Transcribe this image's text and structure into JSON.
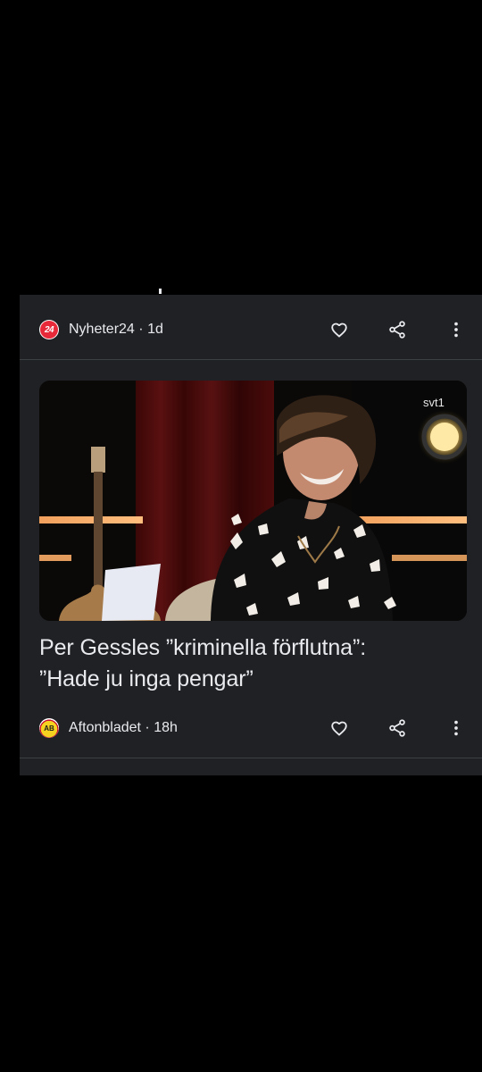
{
  "article_1": {
    "source_name": "Nyheter24",
    "age": "1d",
    "logo_text": "24"
  },
  "article_2": {
    "headline_line_1": "Per Gessles ”kriminella förflutna”:",
    "headline_line_2": "”Hade ju inga pengar”",
    "image_watermark": "svt1",
    "source_name": "Aftonbladet",
    "age": "18h",
    "logo_text": "AB"
  },
  "separator": "·",
  "icons": {
    "like": "heart-outline-icon",
    "share": "share-icon",
    "menu": "more-vertical-icon"
  },
  "colors": {
    "background": "#000000",
    "card": "#202124",
    "text": "#e8eaed",
    "divider": "#3c4043",
    "nyheter24_logo": "#e8293a",
    "aftonbladet_logo": "#f4d21f"
  }
}
